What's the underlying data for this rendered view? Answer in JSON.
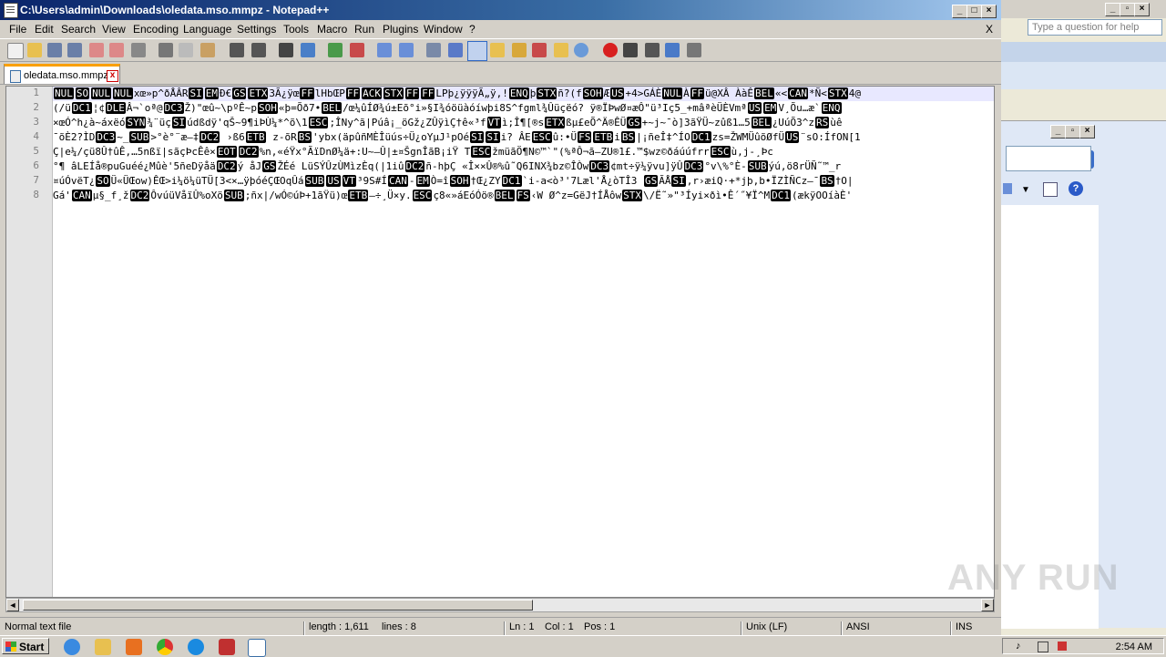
{
  "window": {
    "title": "C:\\Users\\admin\\Downloads\\oledata.mso.mmpz - Notepad++",
    "close_x": "X"
  },
  "menu": [
    "File",
    "Edit",
    "Search",
    "View",
    "Encoding",
    "Language",
    "Settings",
    "Tools",
    "Macro",
    "Run",
    "Plugins",
    "Window",
    "?"
  ],
  "tab": {
    "label": "oledata.mso.mmpz",
    "close": "x"
  },
  "line_numbers": [
    "1",
    "2",
    "3",
    "4",
    "5",
    "6",
    "7",
    "8"
  ],
  "lines": [
    [
      {
        "c": "NUL"
      },
      {
        "c": "SO"
      },
      {
        "c": "NUL"
      },
      {
        "c": "NUL"
      },
      {
        "t": "xœ»p^ðÅÂR"
      },
      {
        "c": "SI"
      },
      {
        "c": "EM"
      },
      {
        "t": "Ð€"
      },
      {
        "c": "GS"
      },
      {
        "c": "ETX"
      },
      {
        "t": "3Ã¿ÿœ"
      },
      {
        "c": "FF"
      },
      {
        "t": "lHbŒP"
      },
      {
        "c": "FF"
      },
      {
        "c": "ACK"
      },
      {
        "c": "STX"
      },
      {
        "c": "FF"
      },
      {
        "c": "FF"
      },
      {
        "t": "LPþ¿ÿÿÿÃ„ÿ,!"
      },
      {
        "c": "ENQ"
      },
      {
        "t": "þ"
      },
      {
        "c": "STX"
      },
      {
        "t": "ñ?(f"
      },
      {
        "c": "SOH"
      },
      {
        "t": "Æ"
      },
      {
        "c": "US"
      },
      {
        "t": "+4>GÁÈ"
      },
      {
        "c": "NUL"
      },
      {
        "t": "À"
      },
      {
        "c": "FF"
      },
      {
        "t": "ü@XÂ  ÀàÊ"
      },
      {
        "c": "BEL"
      },
      {
        "t": "«<"
      },
      {
        "c": "CAN"
      },
      {
        "t": "*Ñ<"
      },
      {
        "c": "STX"
      },
      {
        "t": "4@"
      }
    ],
    [
      {
        "t": "(/ü"
      },
      {
        "c": "DC1"
      },
      {
        "t": "¦¢"
      },
      {
        "c": "DLE"
      },
      {
        "t": "Â¬`oª@"
      },
      {
        "c": "DC3"
      },
      {
        "t": "Ž)\"œû~\\pºÊ~p"
      },
      {
        "c": "SOH"
      },
      {
        "t": "«þ=Õð7•"
      },
      {
        "c": "BEL"
      },
      {
        "t": "/œ¼ûÍØ¾ú±Eõ°i»§I¾óöüàóíwþi8S^fgml¾Ûüçëó? ÿ®ÏÞwØ¤æÔ\"ü³Iç5_+mâªèÜÈVmª"
      },
      {
        "c": "US"
      },
      {
        "c": "EM"
      },
      {
        "t": "V¸Õu…æ`"
      },
      {
        "c": "ENQ"
      }
    ],
    [
      {
        "t": "×œÓ^h¿à~áxëó"
      },
      {
        "c": "SYN"
      },
      {
        "t": "¾¨üç"
      },
      {
        "c": "SI"
      },
      {
        "t": "údßdÿ'qŠ~9¶iÞÙ¼*^õ\\1"
      },
      {
        "c": "ESC"
      },
      {
        "t": ";ÎNy^ã|Púâ¡_öGž¿ZÛÿìÇ†ê«³f"
      },
      {
        "c": "VT"
      },
      {
        "t": "ì;Î¶[®s"
      },
      {
        "c": "ETX"
      },
      {
        "t": "ßµ£eÕ^Ä®ÊÜ"
      },
      {
        "c": "GS"
      },
      {
        "t": "+~j~¯ò]3ãŸÜ~zûß1…5"
      },
      {
        "c": "BEL"
      },
      {
        "t": "¿UúÕ3^z"
      },
      {
        "c": "RS"
      },
      {
        "t": "ùê"
      }
    ],
    [
      {
        "t": "¯õÈ2?ÌD"
      },
      {
        "c": "DC3"
      },
      {
        "t": "~_"
      },
      {
        "c": "SUB"
      },
      {
        "t": ">°è°¨æ—‡"
      },
      {
        "c": "DC2"
      },
      {
        "t": " ›ß6"
      },
      {
        "c": "ETB"
      },
      {
        "t": " z-õR"
      },
      {
        "c": "BS"
      },
      {
        "t": "'ybx(äpûñMÈÎüús÷Ü¿oYµJ¹pOé"
      },
      {
        "c": "SI"
      },
      {
        "c": "SI"
      },
      {
        "t": "i? ÂE"
      },
      {
        "c": "ESC"
      },
      {
        "t": "û:•Ü"
      },
      {
        "c": "FS"
      },
      {
        "c": "ETB"
      },
      {
        "t": "i"
      },
      {
        "c": "BS"
      },
      {
        "t": "|¡ñeÎ‡^ÍO"
      },
      {
        "c": "DC1"
      },
      {
        "t": "zs=ŽWMÜûõØfÜ"
      },
      {
        "c": "US"
      },
      {
        "t": "¨sO:ÍfON[1"
      }
    ],
    [
      {
        "t": "Ç|e¼/çü8Û†ûÊ,…5nßï|sãçÞcÊê×"
      },
      {
        "c": "EOT"
      },
      {
        "c": "DC2"
      },
      {
        "t": "%n,«éŸx°ÃïDnØ¼ä+:U~–Û|±¤ŠgnÎãB¡iŸ T"
      },
      {
        "c": "ESC"
      },
      {
        "t": "žmüãÖ¶N©™`\"(%ªÔ¬ã—ZU®1£.™$wz©ðáúúfrr"
      },
      {
        "c": "ESC"
      },
      {
        "t": "ù,j-¸Þc"
      }
    ],
    [
      {
        "t": "°¶ âLEÍå®puGuéé¿Mûè'5ñeDÿåä"
      },
      {
        "c": "DC2"
      },
      {
        "t": "ý åJ"
      },
      {
        "c": "GS"
      },
      {
        "t": "ŽÉé LüSÝÛzÙMìzÈq(|1iû"
      },
      {
        "c": "DC2"
      },
      {
        "t": "ñ-hþÇ «Î××Û®%û˜Q6INX¾bz©ÎÒw"
      },
      {
        "c": "DC3"
      },
      {
        "t": "¢mt÷ÿ¼ÿvu]ÿÛ"
      },
      {
        "c": "DC3"
      },
      {
        "t": "°v\\%°È-"
      },
      {
        "c": "SUB"
      },
      {
        "t": "ýú,ö8rÜÑ˜™_r"
      }
    ],
    [
      {
        "t": "¤úÓvëT¿"
      },
      {
        "c": "SO"
      },
      {
        "t": "Ü«ÜŒow)ÊŒ>i¼ö¼üTÜ[3<×…ÿþóéÇŒOqÛá"
      },
      {
        "c": "SUB"
      },
      {
        "c": "US"
      },
      {
        "c": "VT"
      },
      {
        "t": "³9S#Í"
      },
      {
        "c": "CAN"
      },
      {
        "t": "-"
      },
      {
        "c": "EM"
      },
      {
        "t": "Ò=î"
      },
      {
        "c": "SOH"
      },
      {
        "t": "†Œ¿ZY"
      },
      {
        "c": "DC1"
      },
      {
        "t": "`i-a<ò³'7Læl'Å¿òTÎ3  "
      },
      {
        "c": "GS"
      },
      {
        "t": "ÃÅ"
      },
      {
        "c": "SI"
      },
      {
        "t": ",r›æiQ·+*jþ,b•ÏZÌÑCz—¯"
      },
      {
        "c": "BS"
      },
      {
        "t": "†O|"
      }
    ],
    [
      {
        "t": "Gá'"
      },
      {
        "c": "CAN"
      },
      {
        "t": "µ§_f¸ž"
      },
      {
        "c": "DC2"
      },
      {
        "t": "ÔvúüVåïÛ%oXö"
      },
      {
        "c": "SUB"
      },
      {
        "t": ";ñx|/wÓ©úÞ+1ãŸü)œ"
      },
      {
        "c": "ETB"
      },
      {
        "t": "—÷¸Ü×y."
      },
      {
        "c": "ESC"
      },
      {
        "t": "ç8«»áEóÓö®"
      },
      {
        "c": "BEL"
      },
      {
        "c": "FS"
      },
      {
        "t": "‹W Ø^z=GëJ†ÍÅôw"
      },
      {
        "c": "STX"
      },
      {
        "t": "\\/Ë˜»\"³Íyi×ðì•Ê´˝¥Ï^M"
      },
      {
        "c": "DC1"
      },
      {
        "t": "(ækÿOOíàÈ'"
      }
    ]
  ],
  "status": {
    "type": "Normal text file",
    "length": "length : 1,611",
    "lines": "lines : 8",
    "ln": "Ln : 1",
    "col": "Col : 1",
    "pos": "Pos : 1",
    "eol": "Unix (LF)",
    "encoding": "ANSI",
    "ins": "INS"
  },
  "right_window": {
    "ask_placeholder": "Type a question for help"
  },
  "taskbar": {
    "start": "Start",
    "clock": "2:54 AM"
  },
  "watermark": "ANY RUN"
}
